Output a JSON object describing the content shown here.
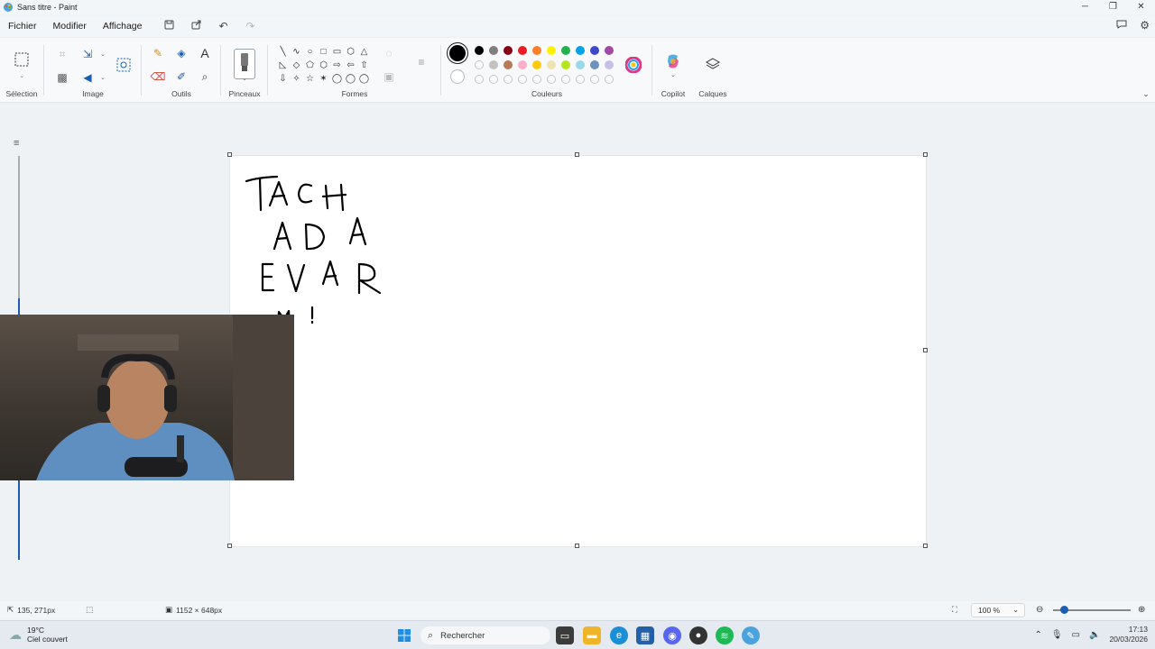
{
  "window": {
    "title": "Sans titre - Paint",
    "controls": [
      "─",
      "❐",
      "✕"
    ]
  },
  "menu": {
    "items": [
      "Fichier",
      "Modifier",
      "Affichage"
    ]
  },
  "ribbon": {
    "groups": {
      "selection": "Sélection",
      "image": "Image",
      "tools": "Outils",
      "brushes": "Pinceaux",
      "shapes": "Formes",
      "colors": "Couleurs",
      "copilot": "Copilot",
      "layers": "Calques"
    },
    "shapes": [
      "╲",
      "∿",
      "○",
      "□",
      "▭",
      "⬡",
      "△",
      "◺",
      "◇",
      "⬠",
      "⬡",
      "⇨",
      "⇦",
      "⇧",
      "⇩",
      "✧",
      "☆",
      "✶",
      "◯",
      "◯",
      "◯"
    ],
    "palette_row1": [
      "#000000",
      "#7f7f7f",
      "#880015",
      "#ed1c24",
      "#ff7f27",
      "#fff200",
      "#22b14c",
      "#00a2e8",
      "#3f48cc",
      "#a349a4"
    ],
    "palette_row2": [
      "empty",
      "#c3c3c3",
      "#b97a57",
      "#ffaec9",
      "#ffc90e",
      "#efe4b0",
      "#b5e61d",
      "#99d9ea",
      "#7092be",
      "#c8bfe7"
    ],
    "palette_row3": [
      "empty",
      "empty",
      "empty",
      "empty",
      "empty",
      "empty",
      "empty",
      "empty",
      "empty",
      "empty"
    ],
    "current_color": "#000000"
  },
  "canvas": {
    "drawing_lines": [
      "TACH",
      "AD A",
      "EVAR",
      "M!"
    ]
  },
  "status": {
    "cursor_pos": "135, 271px",
    "canvas_size": "1152 × 648px",
    "zoom": "100 %"
  },
  "taskbar": {
    "temperature": "19°C",
    "weather": "Ciel couvert",
    "search_placeholder": "Rechercher",
    "time": "17:13",
    "date": "20/03/2026"
  }
}
